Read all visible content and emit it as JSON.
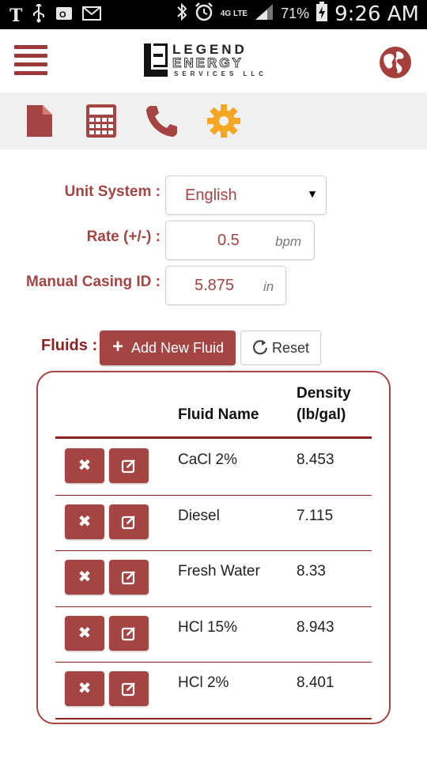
{
  "status_bar": {
    "carrier_glyph": "T",
    "battery_percent": "71%",
    "time": "9:26 AM",
    "network": "4G LTE"
  },
  "header": {
    "logo_line1": "LEGEND",
    "logo_line2": "ENERGY",
    "logo_line3": "SERVICES LLC",
    "menu_icon": "hamburger-icon",
    "globe_icon": "globe-icon"
  },
  "toolbar": {
    "icons": [
      "document-icon",
      "calculator-icon",
      "phone-icon",
      "gear-icon"
    ]
  },
  "form": {
    "unit_system_label": "Unit System :",
    "unit_system_value": "English",
    "rate_label": "Rate (+/-) :",
    "rate_value": "0.5",
    "rate_unit": "bpm",
    "casing_label": "Manual Casing ID :",
    "casing_value": "5.875",
    "casing_unit": "in"
  },
  "fluids": {
    "label": "Fluids :",
    "add_label": "Add New Fluid",
    "reset_label": "Reset",
    "col_name": "Fluid Name",
    "col_density_line1": "Density",
    "col_density_line2": "(lb/gal)",
    "rows": [
      {
        "name": "CaCl 2%",
        "density": "8.453"
      },
      {
        "name": "Diesel",
        "density": "7.115"
      },
      {
        "name": "Fresh Water",
        "density": "8.33"
      },
      {
        "name": "HCl 15%",
        "density": "8.943"
      },
      {
        "name": "HCl 2%",
        "density": "8.401"
      }
    ]
  },
  "colors": {
    "accent": "#a44443",
    "gear": "#f5a623",
    "status_bar": "#000000"
  }
}
